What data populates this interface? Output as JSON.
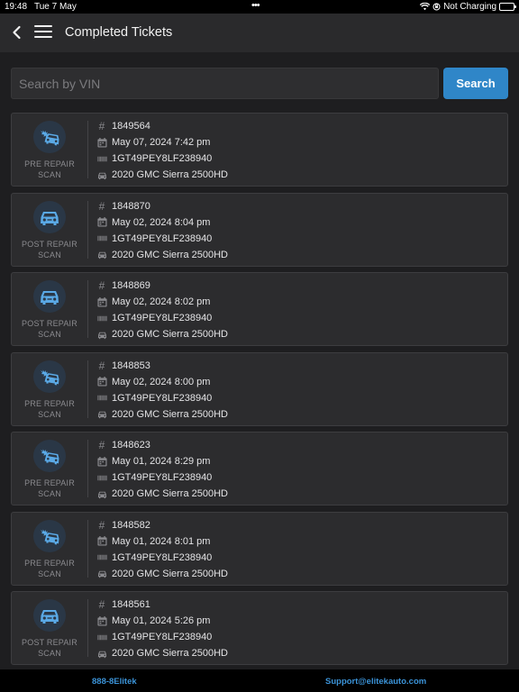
{
  "status_bar": {
    "time": "19:48",
    "date": "Tue 7 May",
    "dots": "•••",
    "charging": "Not Charging"
  },
  "header": {
    "title": "Completed Tickets"
  },
  "search": {
    "placeholder": "Search by VIN",
    "value": "",
    "button_label": "Search"
  },
  "tickets": [
    {
      "scan_type": "pre",
      "scan_line1": "PRE REPAIR",
      "scan_line2": "SCAN",
      "number": "1849564",
      "date": "May 07, 2024 7:42 pm",
      "vin": "1GT49PEY8LF238940",
      "vehicle": "2020 GMC Sierra 2500HD"
    },
    {
      "scan_type": "post",
      "scan_line1": "POST REPAIR",
      "scan_line2": "SCAN",
      "number": "1848870",
      "date": "May 02, 2024 8:04 pm",
      "vin": "1GT49PEY8LF238940",
      "vehicle": "2020 GMC Sierra 2500HD"
    },
    {
      "scan_type": "post",
      "scan_line1": "POST REPAIR",
      "scan_line2": "SCAN",
      "number": "1848869",
      "date": "May 02, 2024 8:02 pm",
      "vin": "1GT49PEY8LF238940",
      "vehicle": "2020 GMC Sierra 2500HD"
    },
    {
      "scan_type": "pre",
      "scan_line1": "PRE REPAIR",
      "scan_line2": "SCAN",
      "number": "1848853",
      "date": "May 02, 2024 8:00 pm",
      "vin": "1GT49PEY8LF238940",
      "vehicle": "2020 GMC Sierra 2500HD"
    },
    {
      "scan_type": "pre",
      "scan_line1": "PRE REPAIR",
      "scan_line2": "SCAN",
      "number": "1848623",
      "date": "May 01, 2024 8:29 pm",
      "vin": "1GT49PEY8LF238940",
      "vehicle": "2020 GMC Sierra 2500HD"
    },
    {
      "scan_type": "pre",
      "scan_line1": "PRE REPAIR",
      "scan_line2": "SCAN",
      "number": "1848582",
      "date": "May 01, 2024 8:01 pm",
      "vin": "1GT49PEY8LF238940",
      "vehicle": "2020 GMC Sierra 2500HD"
    },
    {
      "scan_type": "post",
      "scan_line1": "POST REPAIR",
      "scan_line2": "SCAN",
      "number": "1848561",
      "date": "May 01, 2024 5:26 pm",
      "vin": "1GT49PEY8LF238940",
      "vehicle": "2020 GMC Sierra 2500HD"
    }
  ],
  "icons": {
    "ticket_number": "hash-icon",
    "date": "calendar-icon",
    "vin": "barcode-icon",
    "vehicle": "car-icon",
    "pre_scan": "car-crash-icon",
    "post_scan": "car-icon"
  },
  "colors": {
    "accent": "#2f86c8",
    "scan_icon": "#5aa9e6",
    "footer_link": "#3b93d8"
  },
  "footer": {
    "phone": "888-8Elitek",
    "email": "Support@elitekauto.com"
  }
}
